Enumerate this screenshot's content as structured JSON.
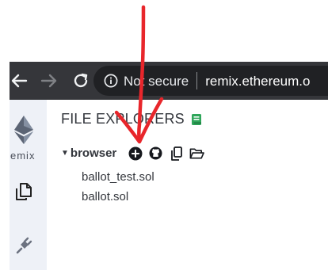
{
  "browser": {
    "security_label": "Not secure",
    "url_text": "remix.ethereum.o"
  },
  "icon_panel": {
    "logo_text": "emix"
  },
  "file_explorer": {
    "title": "FILE EXPLORERS",
    "folder_label": "browser",
    "files": [
      {
        "name": "ballot_test.sol"
      },
      {
        "name": "ballot.sol"
      }
    ]
  },
  "colors": {
    "browser_bar": "#35363a",
    "omnibox": "#202124",
    "icon_panel": "#eef1f7",
    "docs_icon": "#2fa65a",
    "annotation": "#e8262b"
  },
  "icons": {
    "back": "arrow-left-icon",
    "forward": "arrow-right-icon",
    "reload": "reload-icon",
    "info": "info-icon",
    "docs": "book-icon",
    "create_file": "plus-circle-icon",
    "github": "github-icon",
    "copy": "copy-icon",
    "open_folder": "folder-open-icon",
    "files_nav": "files-icon",
    "plugin_nav": "plug-icon",
    "logo": "ethereum-icon"
  }
}
